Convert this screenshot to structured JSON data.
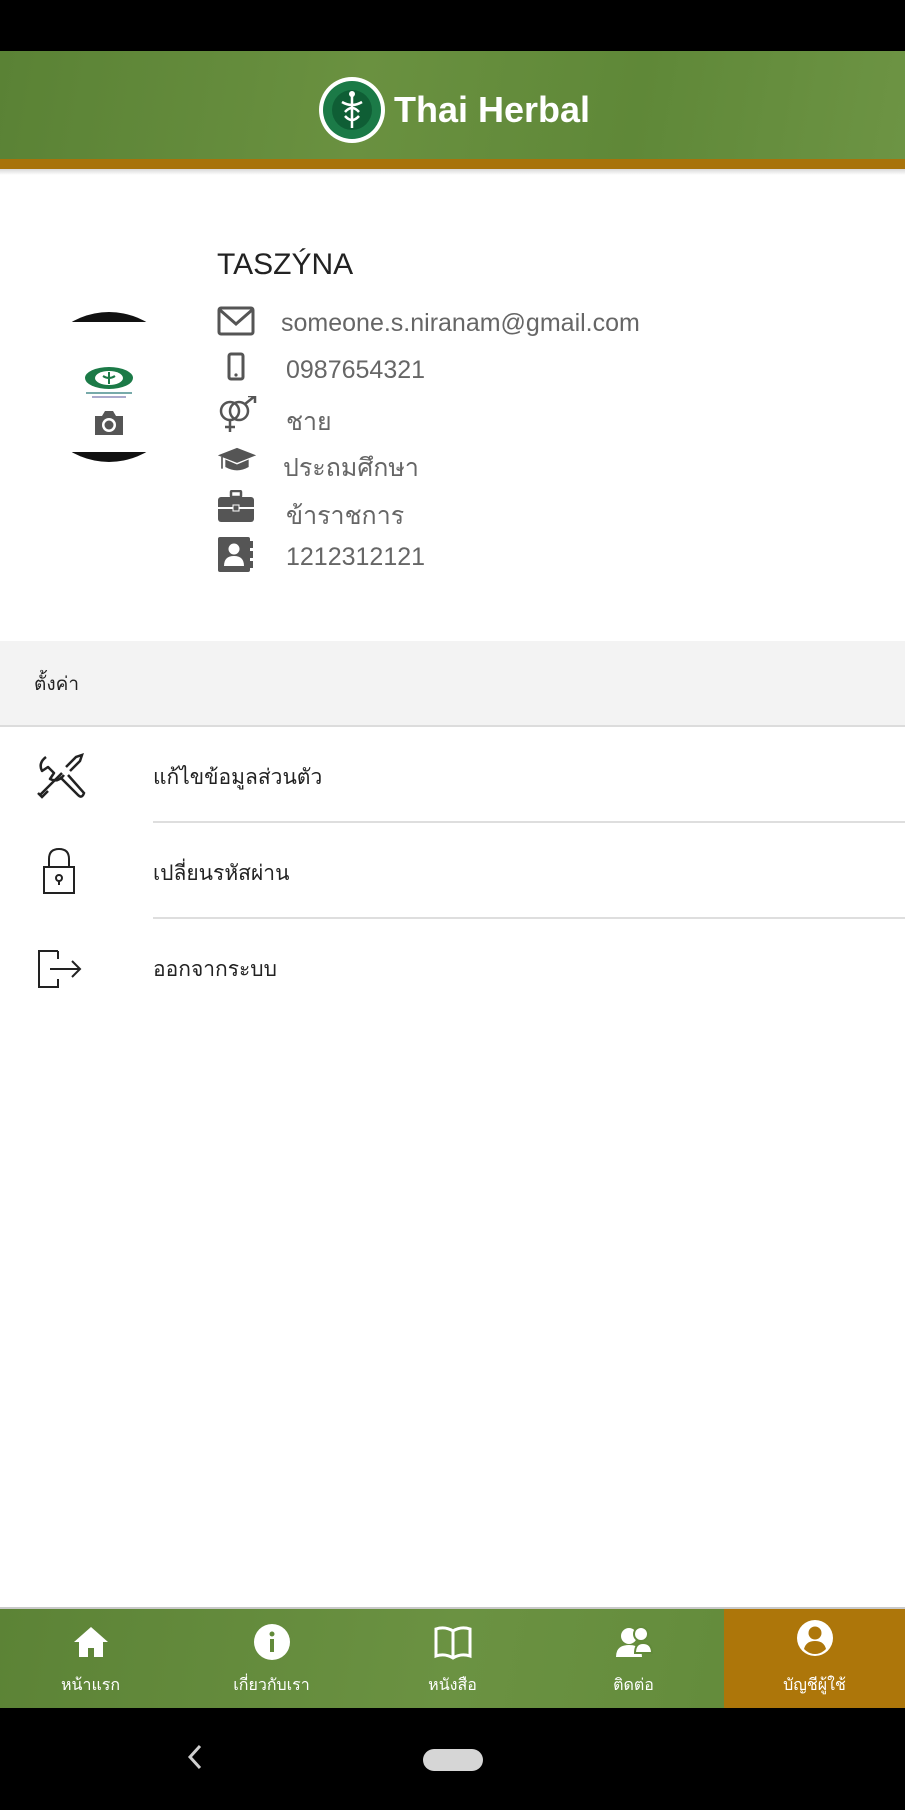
{
  "header": {
    "title": "Thai Herbal",
    "bg_color": "#628a3a",
    "strip_color": "#a8730a"
  },
  "profile": {
    "name": "TASZÝNA",
    "email": "someone.s.niranam@gmail.com",
    "phone": "0987654321",
    "gender": "ชาย",
    "education": "ประถมศึกษา",
    "occupation": "ข้าราชการ",
    "id_number": "1212312121"
  },
  "settings": {
    "section_label": "ตั้งค่า",
    "items": [
      {
        "label": "แก้ไขข้อมูลส่วนตัว",
        "icon": "tools-icon"
      },
      {
        "label": "เปลี่ยนรหัสผ่าน",
        "icon": "lock-icon"
      },
      {
        "label": "ออกจากระบบ",
        "icon": "logout-icon"
      }
    ]
  },
  "tabs": [
    {
      "label": "หน้าแรก",
      "icon": "home-icon"
    },
    {
      "label": "เกี่ยวกับเรา",
      "icon": "info-icon"
    },
    {
      "label": "หนังสือ",
      "icon": "book-icon"
    },
    {
      "label": "ติดต่อ",
      "icon": "contact-icon"
    },
    {
      "label": "บัญชีผู้ใช้",
      "icon": "account-icon",
      "active": true
    }
  ],
  "active_tab_color": "#ad760a"
}
